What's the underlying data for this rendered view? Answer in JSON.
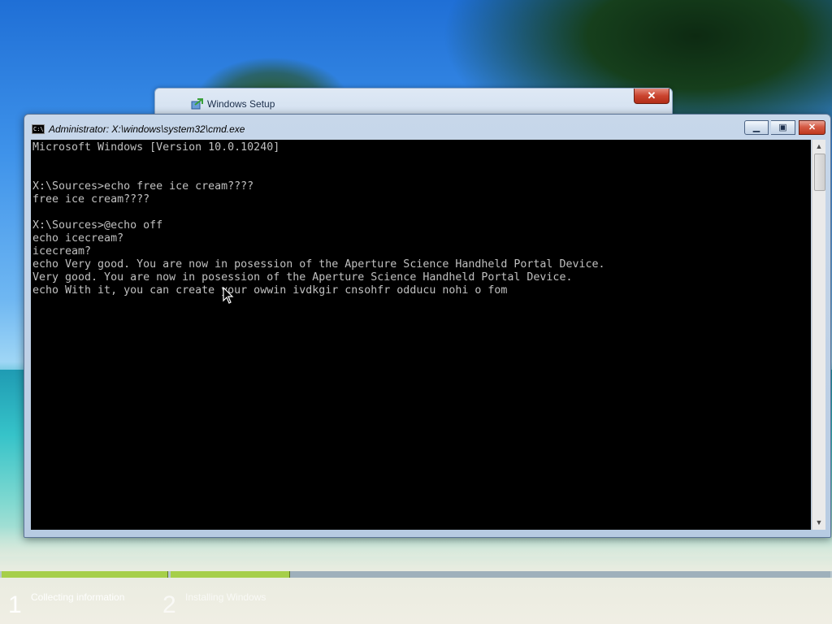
{
  "colors": {
    "console_background": "#000000",
    "console_text": "#c0c0c0",
    "progress_fill": "#a6cf4a"
  },
  "setup_window": {
    "title": "Windows Setup",
    "close_icon": "close-icon"
  },
  "cmd_window": {
    "title": "Administrator: X:\\windows\\system32\\cmd.exe",
    "icon_text": "C:\\",
    "buttons": {
      "minimize_icon": "minimize-icon",
      "maximize_icon": "maximize-icon",
      "close_icon": "close-icon"
    },
    "console_lines": [
      "Microsoft Windows [Version 10.0.10240]",
      "",
      "",
      "X:\\Sources>echo free ice cream????",
      "free ice cream????",
      "",
      "X:\\Sources>@echo off",
      "echo icecream?",
      "icecream?",
      "echo Very good. You are now in posession of the Aperture Science Handheld Portal Device.",
      "Very good. You are now in posession of the Aperture Science Handheld Portal Device.",
      "echo With it, you can create your owwin ivdkgir cnsohfr odducu nohi o fom"
    ]
  },
  "setup_progress": {
    "steps": [
      {
        "number": "1",
        "label": "Collecting information"
      },
      {
        "number": "2",
        "label": "Installing Windows"
      }
    ],
    "step2_progress": 0.18
  }
}
